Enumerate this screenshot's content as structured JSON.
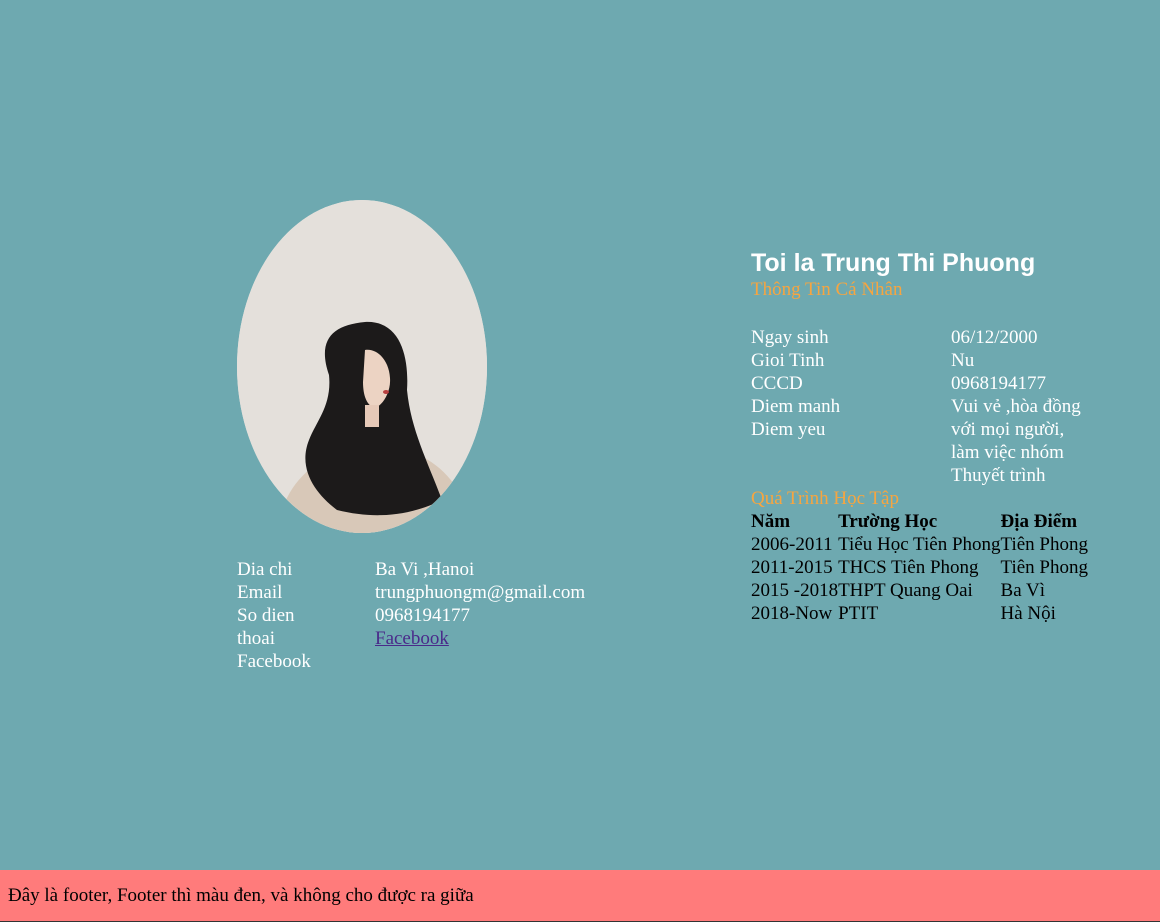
{
  "profile": {
    "name": "Toi la Trung Thi Phuong",
    "personal_title": "Thông Tin Cá Nhân",
    "education_title": "Quá Trình Học Tập"
  },
  "contact": {
    "labels": [
      "Dia chi",
      "Email",
      "So dien",
      "thoai",
      "Facebook"
    ],
    "address": "Ba Vi ,Hanoi",
    "email": "trungphuongm@gmail.com",
    "phone": "0968194177",
    "facebook_link": "Facebook"
  },
  "info": {
    "labels": [
      "Ngay sinh",
      "Gioi Tinh",
      "CCCD",
      "Diem manh",
      "Diem yeu"
    ],
    "birthday": "06/12/2000",
    "gender": "Nu",
    "cccd": "0968194177",
    "strengths": [
      "Vui vẻ ,hòa đồng",
      "với mọi người,",
      "làm việc nhóm"
    ],
    "weakness": "Thuyết trình"
  },
  "education": {
    "headers": [
      "Năm",
      "Trường Học",
      "Địa Điểm"
    ],
    "rows": [
      [
        "2006-2011",
        "Tiểu Học Tiên Phong",
        "Tiên Phong"
      ],
      [
        "2011-2015",
        "THCS Tiên Phong",
        "Tiên Phong"
      ],
      [
        "2015 -2018",
        "THPT Quang Oai",
        "Ba Vì"
      ],
      [
        "2018-Now",
        "PTIT",
        "Hà Nội"
      ]
    ]
  },
  "footer": {
    "text": "Đây là footer, Footer thì màu đen, và không cho được ra giữa"
  },
  "colors": {
    "background": "#6ea9b0",
    "accent": "#f6a540",
    "footer": "#ff7b7b"
  }
}
